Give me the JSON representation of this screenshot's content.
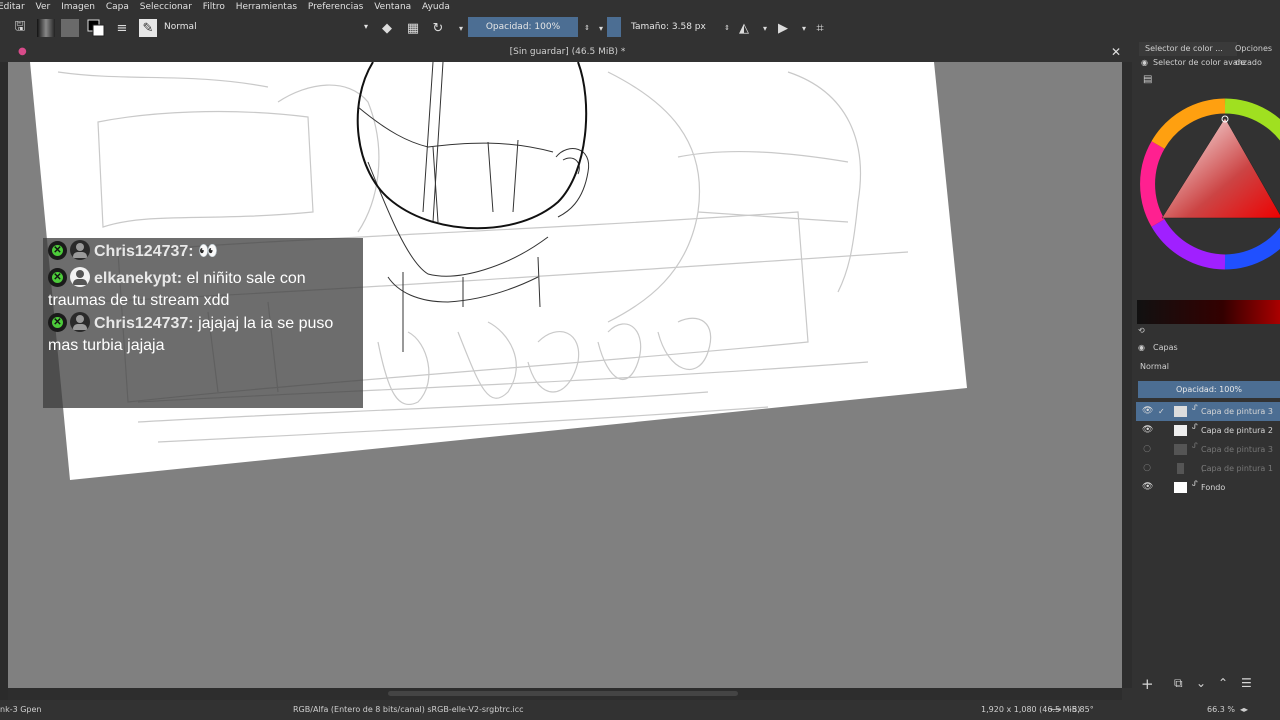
{
  "menu": [
    "Editar",
    "Ver",
    "Imagen",
    "Capa",
    "Seleccionar",
    "Filtro",
    "Herramientas",
    "Preferencias",
    "Ventana",
    "Ayuda"
  ],
  "toolbar": {
    "blend_mode": "Normal",
    "opacity": "Opacidad: 100%",
    "size": "Tamaño: 3.58 px"
  },
  "document": {
    "title": "[Sin guardar]  (46.5 MiB) *"
  },
  "chat": [
    {
      "user": "Chris124737:",
      "message": "👀",
      "avatar": "dark"
    },
    {
      "user": "elkanekypt:",
      "message": "el niñito sale con traumas de tu stream xdd",
      "avatar": "white"
    },
    {
      "user": "Chris124737:",
      "message": "jajajaj la ia se puso mas turbia jajaja",
      "avatar": "dark"
    }
  ],
  "docker": {
    "tabs": [
      "Selector de color ...",
      "Opciones de"
    ],
    "color_selector_title": "Selector de color avanzado",
    "layers_title": "Capas",
    "layer_blend": "Normal",
    "layer_opacity": "Opacidad:  100%",
    "layers": [
      {
        "name": "Capa de pintura 3",
        "selected": true,
        "visible": true
      },
      {
        "name": "Capa de pintura 2",
        "selected": false,
        "visible": true
      },
      {
        "name": "Capa de pintura 3 (...",
        "selected": false,
        "visible": false
      },
      {
        "name": "Capa de pintura 1",
        "selected": false,
        "visible": false
      },
      {
        "name": "Fondo",
        "selected": false,
        "visible": true
      }
    ]
  },
  "status": {
    "brush": "nk-3 Gpen",
    "color_space": "RGB/Alfa (Entero de 8 bits/canal)  sRGB-elle-V2-srgbtrc.icc",
    "dimensions": "1,920 x 1,080 (46.5 MiB)",
    "rotation": "-5.85°",
    "zoom": "66.3 %"
  },
  "colors": {
    "accent": "#4c6e93",
    "panel": "#323232",
    "canvas_bg": "#808080",
    "badge_green": "#4ccb3a"
  }
}
